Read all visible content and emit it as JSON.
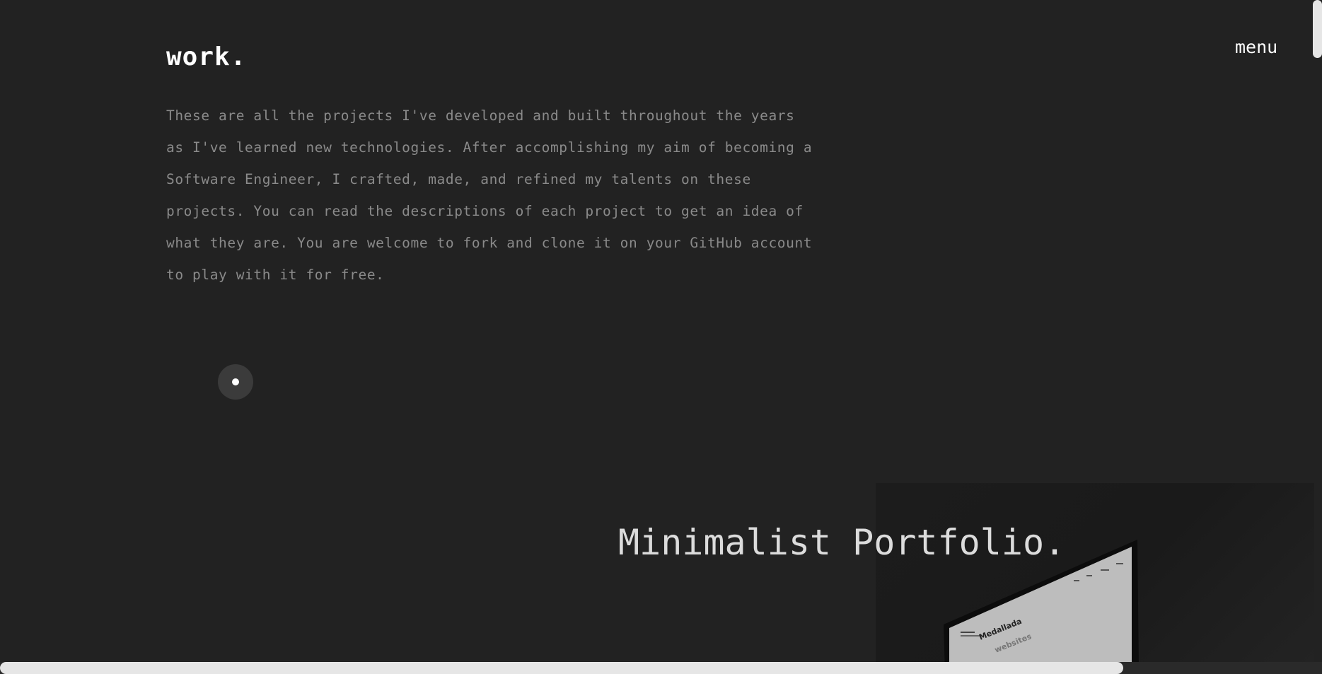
{
  "header": {
    "logo": "work.",
    "menu_label": "menu"
  },
  "intro": {
    "text": "These are all the projects I've developed and built throughout the years as I've learned new technologies. After accomplishing my aim of becoming a Software Engineer, I crafted, made, and refined my talents on these projects. You can read the descriptions of each project to get an idea of what they are. You are welcome to fork and clone it on your GitHub account to play with it for free."
  },
  "projects": [
    {
      "title": "Minimalist Portfolio.",
      "preview_headline_1": "Medallada",
      "preview_headline_2": "websites"
    }
  ],
  "icons": {
    "cursor": "cursor-dot-icon"
  },
  "colors": {
    "background": "#222222",
    "text_primary": "#ffffff",
    "text_muted": "#8a8a8a",
    "title": "#dcdcdc"
  }
}
